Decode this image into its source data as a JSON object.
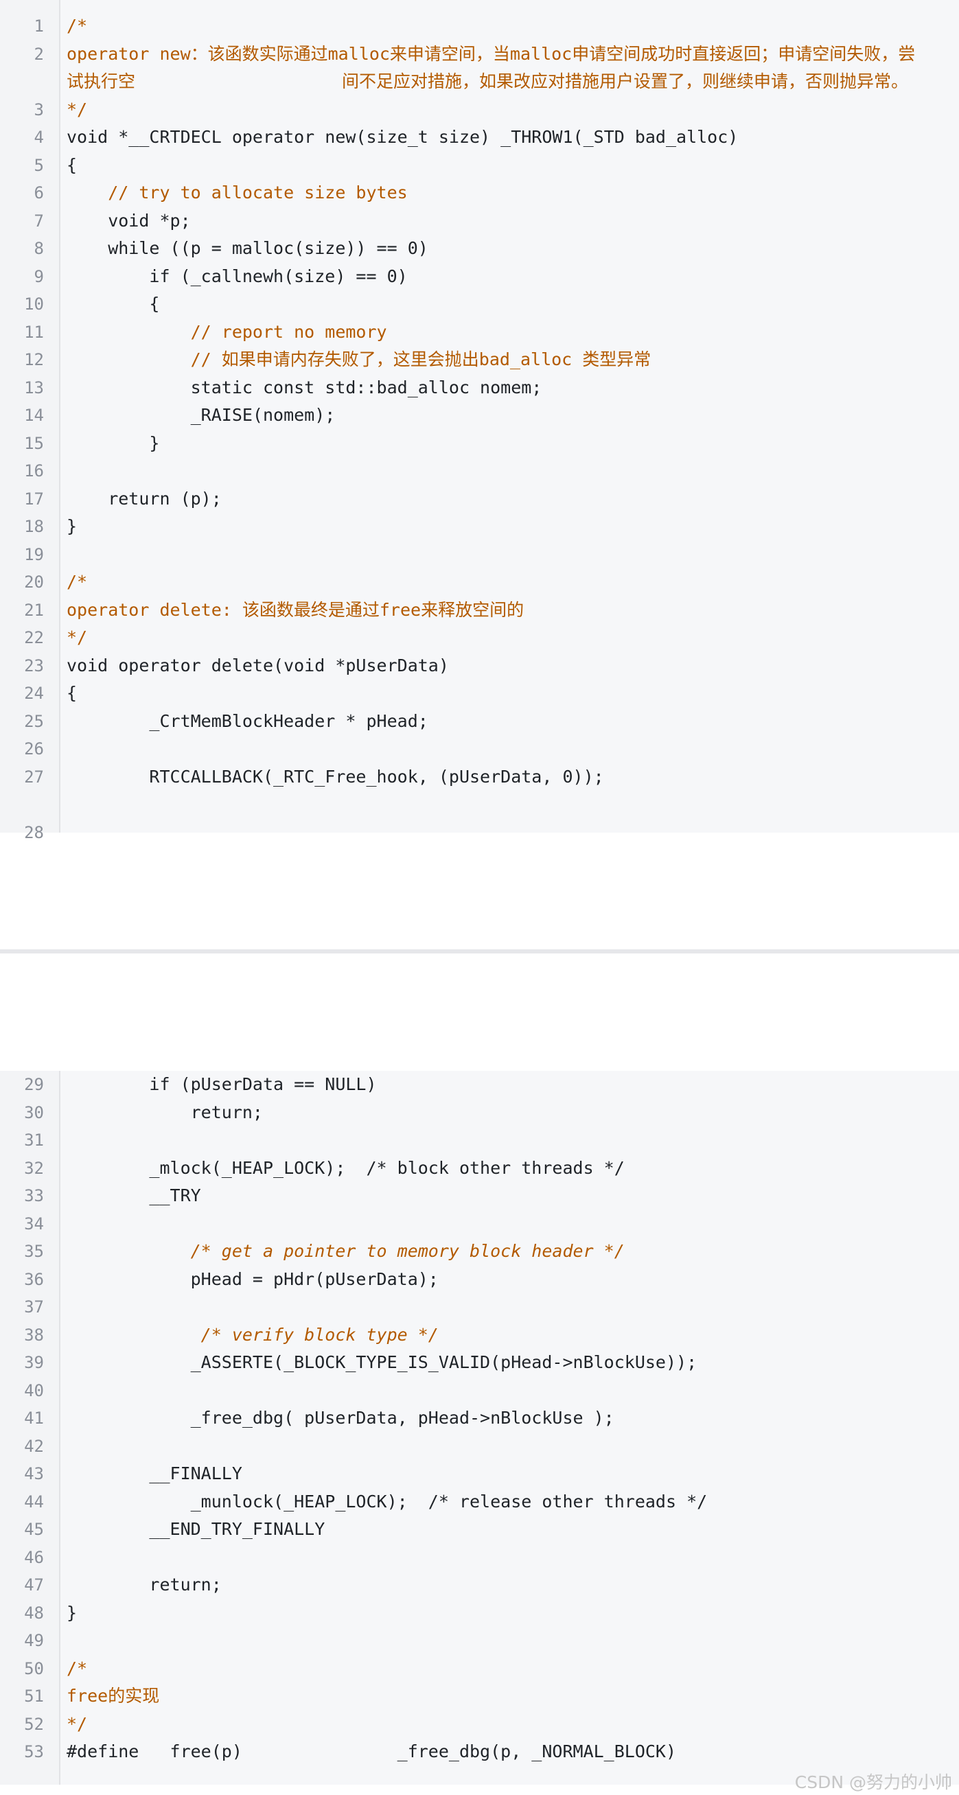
{
  "watermark": "CSDN @努力的小帅",
  "colors": {
    "comment": "#b35a00",
    "keyword": "#7a1fa2",
    "type": "#1f7a6b",
    "plain": "#1f2328",
    "line_number": "#8a8f98",
    "background": "#f6f7f9"
  },
  "panel1": {
    "lines": [
      {
        "n": "1",
        "text": "/*",
        "style": "comment"
      },
      {
        "n": "2",
        "text": "operator new：该函数实际通过malloc来申请空间，当malloc申请空间成功时直接返回；申请空间失败，尝试执行空                    间不足应对措施，如果改应对措施用户设置了，则继续申请，否则抛异常。",
        "style": "comment",
        "wrapped": true
      },
      {
        "n": "3",
        "text": "*/",
        "style": "comment"
      },
      {
        "n": "4",
        "text": "void *__CRTDECL operator new(size_t size) _THROW1(_STD bad_alloc)",
        "style": "plain"
      },
      {
        "n": "5",
        "text": "{",
        "style": "plain"
      },
      {
        "n": "6",
        "text": "    // try to allocate size bytes",
        "style": "comment"
      },
      {
        "n": "7",
        "text": "    void *p;",
        "style": "plain"
      },
      {
        "n": "8",
        "text": "    while ((p = malloc(size)) == 0)",
        "style": "plain"
      },
      {
        "n": "9",
        "text": "        if (_callnewh(size) == 0)",
        "style": "plain"
      },
      {
        "n": "10",
        "text": "        {",
        "style": "plain"
      },
      {
        "n": "11",
        "text": "            // report no memory",
        "style": "comment"
      },
      {
        "n": "12",
        "text": "            // 如果申请内存失败了，这里会抛出bad_alloc 类型异常",
        "style": "comment"
      },
      {
        "n": "13",
        "text": "            static const std::bad_alloc nomem;",
        "style": "plain"
      },
      {
        "n": "14",
        "text": "            _RAISE(nomem);",
        "style": "plain"
      },
      {
        "n": "15",
        "text": "        }",
        "style": "plain"
      },
      {
        "n": "16",
        "text": "",
        "style": "plain"
      },
      {
        "n": "17",
        "text": "    return (p);",
        "style": "plain"
      },
      {
        "n": "18",
        "text": "}",
        "style": "plain"
      },
      {
        "n": "19",
        "text": "",
        "style": "plain"
      },
      {
        "n": "20",
        "text": "/*",
        "style": "comment"
      },
      {
        "n": "21",
        "text": "operator delete: 该函数最终是通过free来释放空间的",
        "style": "comment"
      },
      {
        "n": "22",
        "text": "*/",
        "style": "comment"
      },
      {
        "n": "23",
        "text": "void operator delete(void *pUserData)",
        "style": "plain"
      },
      {
        "n": "24",
        "text": "{",
        "style": "plain"
      },
      {
        "n": "25",
        "text": "        _CrtMemBlockHeader * pHead;",
        "style": "plain"
      },
      {
        "n": "26",
        "text": "",
        "style": "plain"
      },
      {
        "n": "27",
        "text": "        RTCCALLBACK(_RTC_Free_hook, (pUserData, 0));",
        "style": "plain"
      },
      {
        "n": "",
        "text": "",
        "style": "plain"
      },
      {
        "n": "28",
        "text": "",
        "style": "plain"
      }
    ]
  },
  "panel2": {
    "lines": [
      {
        "n": "29",
        "text": "        if (pUserData == NULL)",
        "style": "plain"
      },
      {
        "n": "30",
        "text": "            return;",
        "style": "plain"
      },
      {
        "n": "31",
        "text": "",
        "style": "plain"
      },
      {
        "n": "32",
        "text": "        _mlock(_HEAP_LOCK);  /* block other threads */",
        "style": "plain"
      },
      {
        "n": "33",
        "text": "        __TRY",
        "style": "plain"
      },
      {
        "n": "34",
        "text": "",
        "style": "plain"
      },
      {
        "n": "35",
        "text": "            /* get a pointer to memory block header */",
        "style": "comment-i"
      },
      {
        "n": "36",
        "text": "            pHead = pHdr(pUserData);",
        "style": "plain"
      },
      {
        "n": "37",
        "text": "",
        "style": "plain"
      },
      {
        "n": "38",
        "text": "             /* verify block type */",
        "style": "comment-i"
      },
      {
        "n": "39",
        "text": "            _ASSERTE(_BLOCK_TYPE_IS_VALID(pHead->nBlockUse));",
        "style": "plain"
      },
      {
        "n": "40",
        "text": "",
        "style": "plain"
      },
      {
        "n": "41",
        "text": "            _free_dbg( pUserData, pHead->nBlockUse );",
        "style": "plain"
      },
      {
        "n": "42",
        "text": "",
        "style": "plain"
      },
      {
        "n": "43",
        "text": "        __FINALLY",
        "style": "plain"
      },
      {
        "n": "44",
        "text": "            _munlock(_HEAP_LOCK);  /* release other threads */",
        "style": "plain"
      },
      {
        "n": "45",
        "text": "        __END_TRY_FINALLY",
        "style": "plain"
      },
      {
        "n": "46",
        "text": "",
        "style": "plain"
      },
      {
        "n": "47",
        "text": "        return;",
        "style": "plain"
      },
      {
        "n": "48",
        "text": "}",
        "style": "plain"
      },
      {
        "n": "49",
        "text": "",
        "style": "plain"
      },
      {
        "n": "50",
        "text": "/*",
        "style": "comment"
      },
      {
        "n": "51",
        "text": "free的实现",
        "style": "comment"
      },
      {
        "n": "52",
        "text": "*/",
        "style": "comment"
      },
      {
        "n": "53",
        "text": "#define   free(p)               _free_dbg(p, _NORMAL_BLOCK)",
        "style": "plain"
      }
    ]
  }
}
